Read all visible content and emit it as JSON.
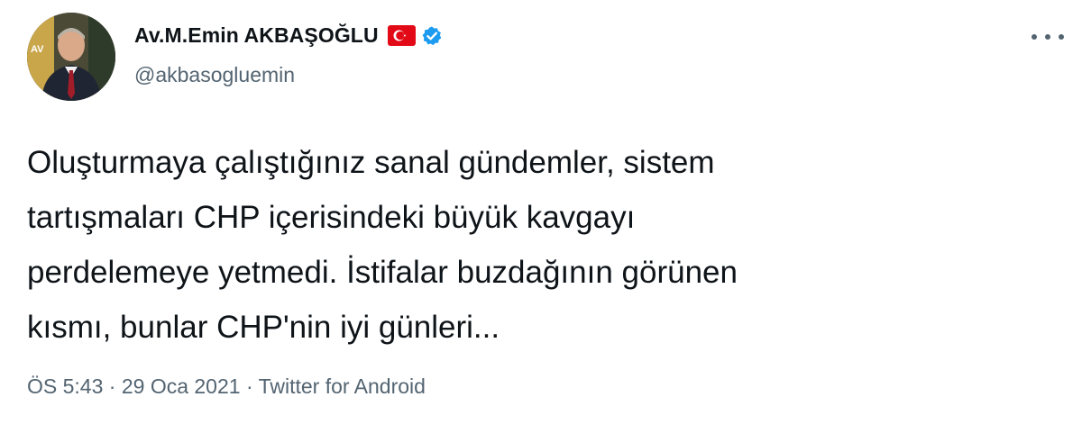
{
  "user": {
    "display_name": "Av.M.Emin AKBAŞOĞLU",
    "handle": "@akbasogluemin"
  },
  "icons": {
    "flag": "turkey-flag-icon",
    "verified": "verified-badge-icon",
    "more": "more-options-icon"
  },
  "colors": {
    "verified": "#1d9bf0",
    "flag_red": "#e30a17",
    "text": "#0f1419",
    "secondary": "#536471"
  },
  "tweet": {
    "text": "Oluşturmaya çalıştığınız sanal gündemler, sistem\ntartışmaları CHP içerisindeki büyük kavgayı\nperdelemeye yetmedi. İstifalar buzdağının görünen\nkısmı, bunlar CHP'nin iyi günleri...",
    "time": "ÖS 5:43",
    "separator": " · ",
    "date": "29 Oca 2021",
    "source": "Twitter for Android"
  }
}
